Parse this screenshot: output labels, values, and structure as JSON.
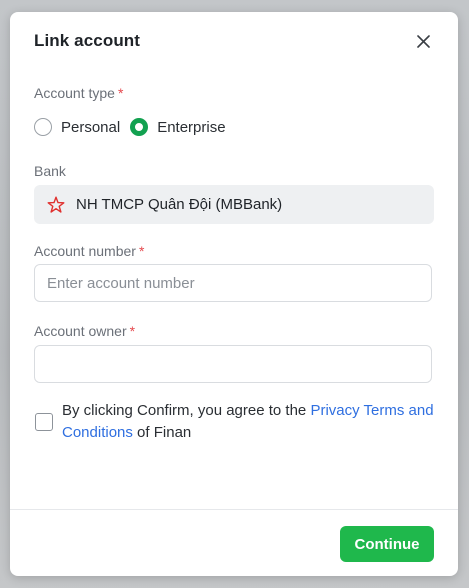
{
  "modal": {
    "title": "Link account"
  },
  "account_type": {
    "label": "Account type",
    "required_mark": "*",
    "options": [
      {
        "label": "Personal",
        "selected": false
      },
      {
        "label": "Enterprise",
        "selected": true
      }
    ]
  },
  "bank": {
    "label": "Bank",
    "value": "NH TMCP Quân Đội (MBBank)",
    "icon": "mbbank-star-icon",
    "icon_color": "#e0312f"
  },
  "account_number": {
    "label": "Account number",
    "required_mark": "*",
    "placeholder": "Enter account number",
    "value": ""
  },
  "account_owner": {
    "label": "Account owner",
    "required_mark": "*",
    "placeholder": "",
    "value": ""
  },
  "consent": {
    "checked": false,
    "text_before": "By clicking Confirm, you agree to the ",
    "link_text": "Privacy Terms and Conditions",
    "text_after": " of Finan"
  },
  "footer": {
    "continue_label": "Continue"
  },
  "colors": {
    "accent_green": "#1fb84c",
    "radio_green": "#12a150",
    "link_blue": "#2f6fe0",
    "required_red": "#e5484d"
  }
}
